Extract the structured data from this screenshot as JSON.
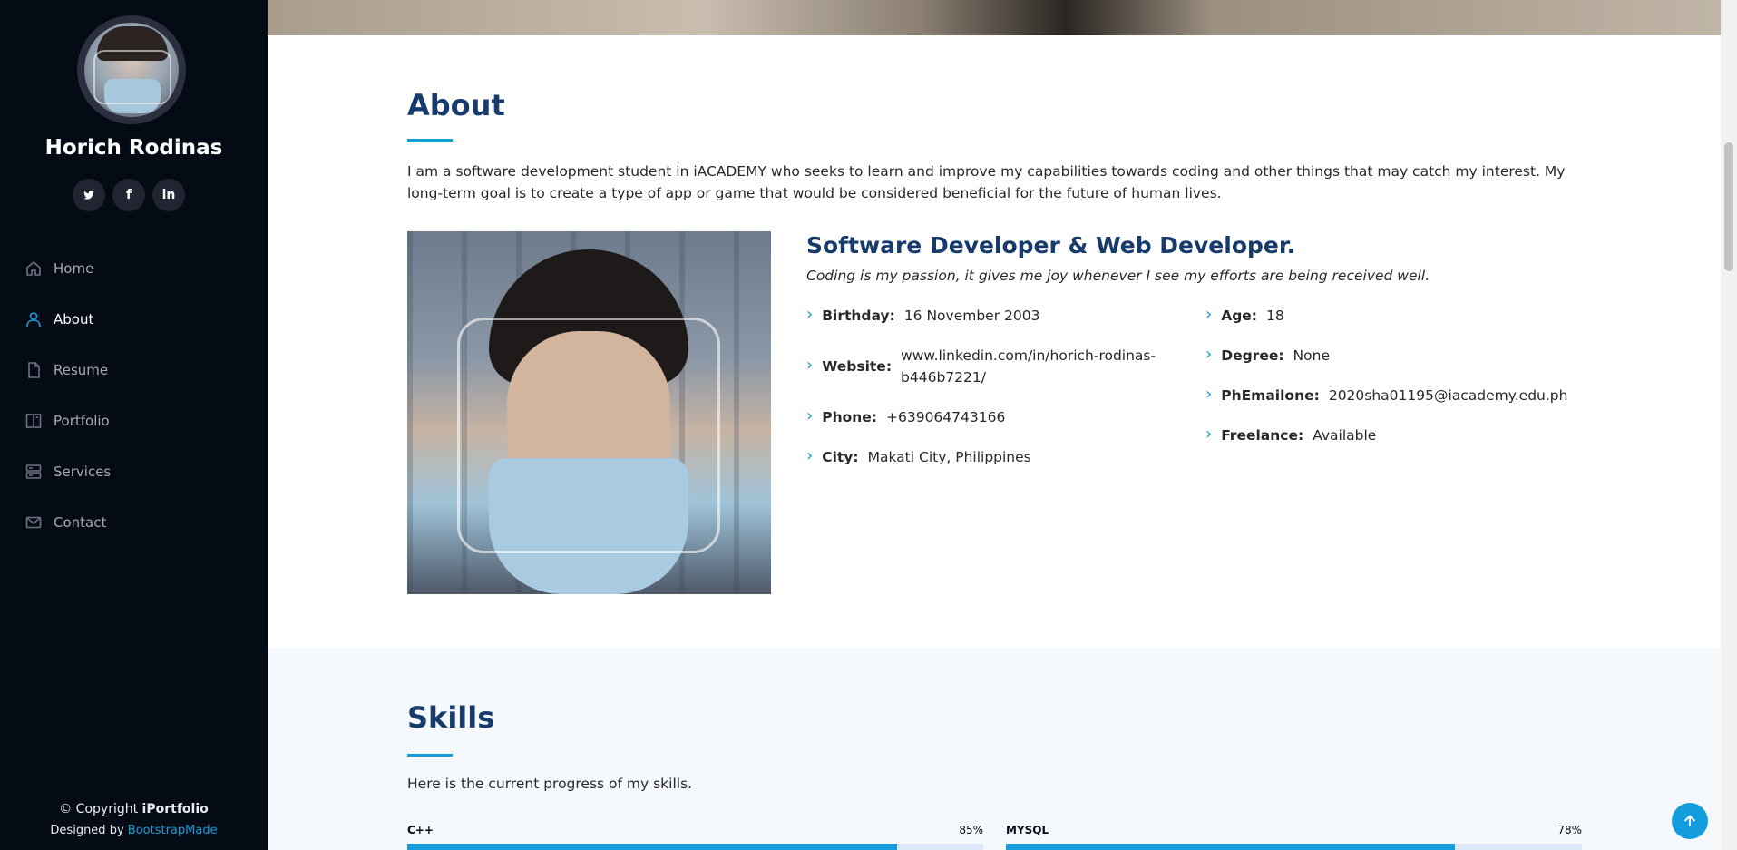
{
  "sidebar": {
    "name": "Horich Rodinas",
    "social": [
      {
        "icon": "twitter-icon",
        "glyph": "🐦"
      },
      {
        "icon": "facebook-icon",
        "glyph": "f"
      },
      {
        "icon": "linkedin-icon",
        "glyph": "in"
      }
    ],
    "nav": [
      {
        "label": "Home",
        "icon": "home-icon",
        "active": false
      },
      {
        "label": "About",
        "icon": "person-icon",
        "active": true
      },
      {
        "label": "Resume",
        "icon": "file-icon",
        "active": false
      },
      {
        "label": "Portfolio",
        "icon": "book-icon",
        "active": false
      },
      {
        "label": "Services",
        "icon": "server-icon",
        "active": false
      },
      {
        "label": "Contact",
        "icon": "envelope-icon",
        "active": false
      }
    ],
    "footer": {
      "copyright_prefix": "© Copyright ",
      "brand": "iPortfolio",
      "designed_by": "Designed by ",
      "designer": "BootstrapMade"
    }
  },
  "about": {
    "title": "About",
    "intro": "I am a software development student in iACADEMY who seeks to learn and improve my capabilities towards coding and other things that may catch my interest. My long-term goal is to create a type of app or game that would be considered beneficial for the future of human lives.",
    "role": "Software Developer & Web Developer.",
    "tagline": "Coding is my passion, it gives me joy whenever I see my efforts are being received well.",
    "left_info": [
      {
        "label": "Birthday:",
        "value": "16 November 2003"
      },
      {
        "label": "Website:",
        "value": "www.linkedin.com/in/horich-rodinas-b446b7221/"
      },
      {
        "label": "Phone:",
        "value": "+639064743166"
      },
      {
        "label": "City:",
        "value": "Makati City, Philippines"
      }
    ],
    "right_info": [
      {
        "label": "Age:",
        "value": "18"
      },
      {
        "label": "Degree:",
        "value": "None"
      },
      {
        "label": "PhEmailone:",
        "value": "2020sha01195@iacademy.edu.ph"
      },
      {
        "label": "Freelance:",
        "value": "Available"
      }
    ]
  },
  "skills": {
    "title": "Skills",
    "intro": "Here is the current progress of my skills.",
    "items": [
      {
        "name": "C++",
        "percent_label": "85%",
        "percent": 85
      },
      {
        "name": "MYSQL",
        "percent_label": "78%",
        "percent": 78
      }
    ]
  },
  "colors": {
    "accent": "#149ddd",
    "sidebar_bg": "#040b14",
    "heading": "#173b6c"
  }
}
